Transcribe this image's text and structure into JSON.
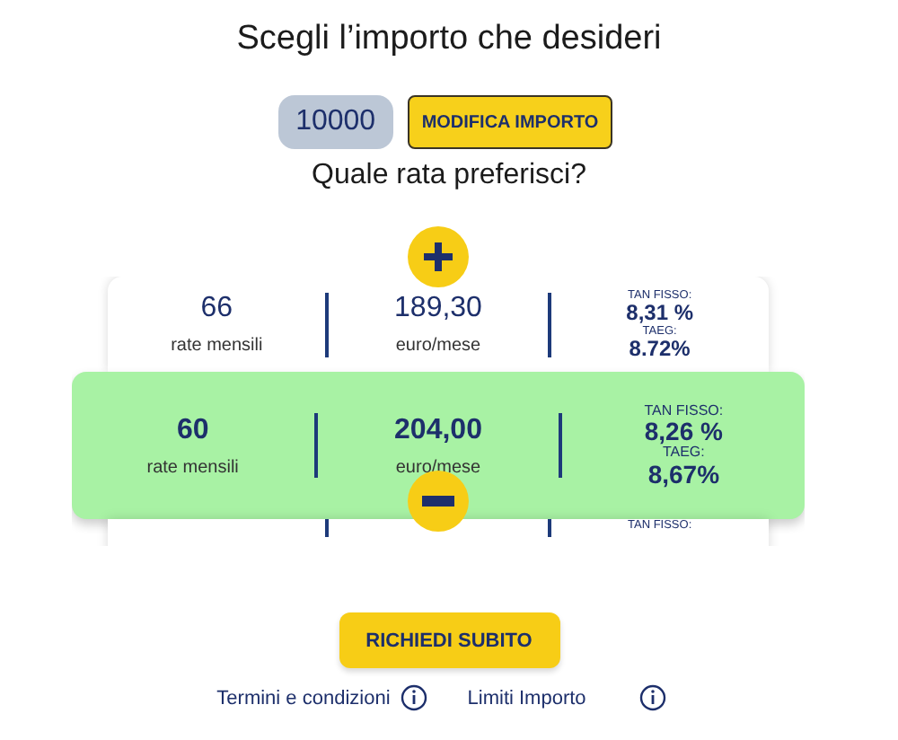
{
  "title": "Scegli l’importo che desideri",
  "amount": {
    "value": "10000"
  },
  "edit_button": "MODIFICA IMPORTO",
  "question": "Quale rata preferisci?",
  "options": [
    {
      "months": "66",
      "months_label": "rate mensili",
      "payment": "189,30",
      "payment_label": "euro/mese",
      "tan_label": "TAN FISSO:",
      "tan": "8,31 %",
      "taeg_label": "TAEG:",
      "taeg": "8.72%",
      "selected": false
    },
    {
      "months": "60",
      "months_label": "rate mensili",
      "payment": "204,00",
      "payment_label": "euro/mese",
      "tan_label": "TAN FISSO:",
      "tan": "8,26 %",
      "taeg_label": "TAEG:",
      "taeg": "8,67%",
      "selected": true
    },
    {
      "tan_label": "TAN FISSO:",
      "selected": false
    }
  ],
  "cta": "RICHIEDI SUBITO",
  "links": [
    "Termini e condizioni",
    "Limiti Importo"
  ]
}
